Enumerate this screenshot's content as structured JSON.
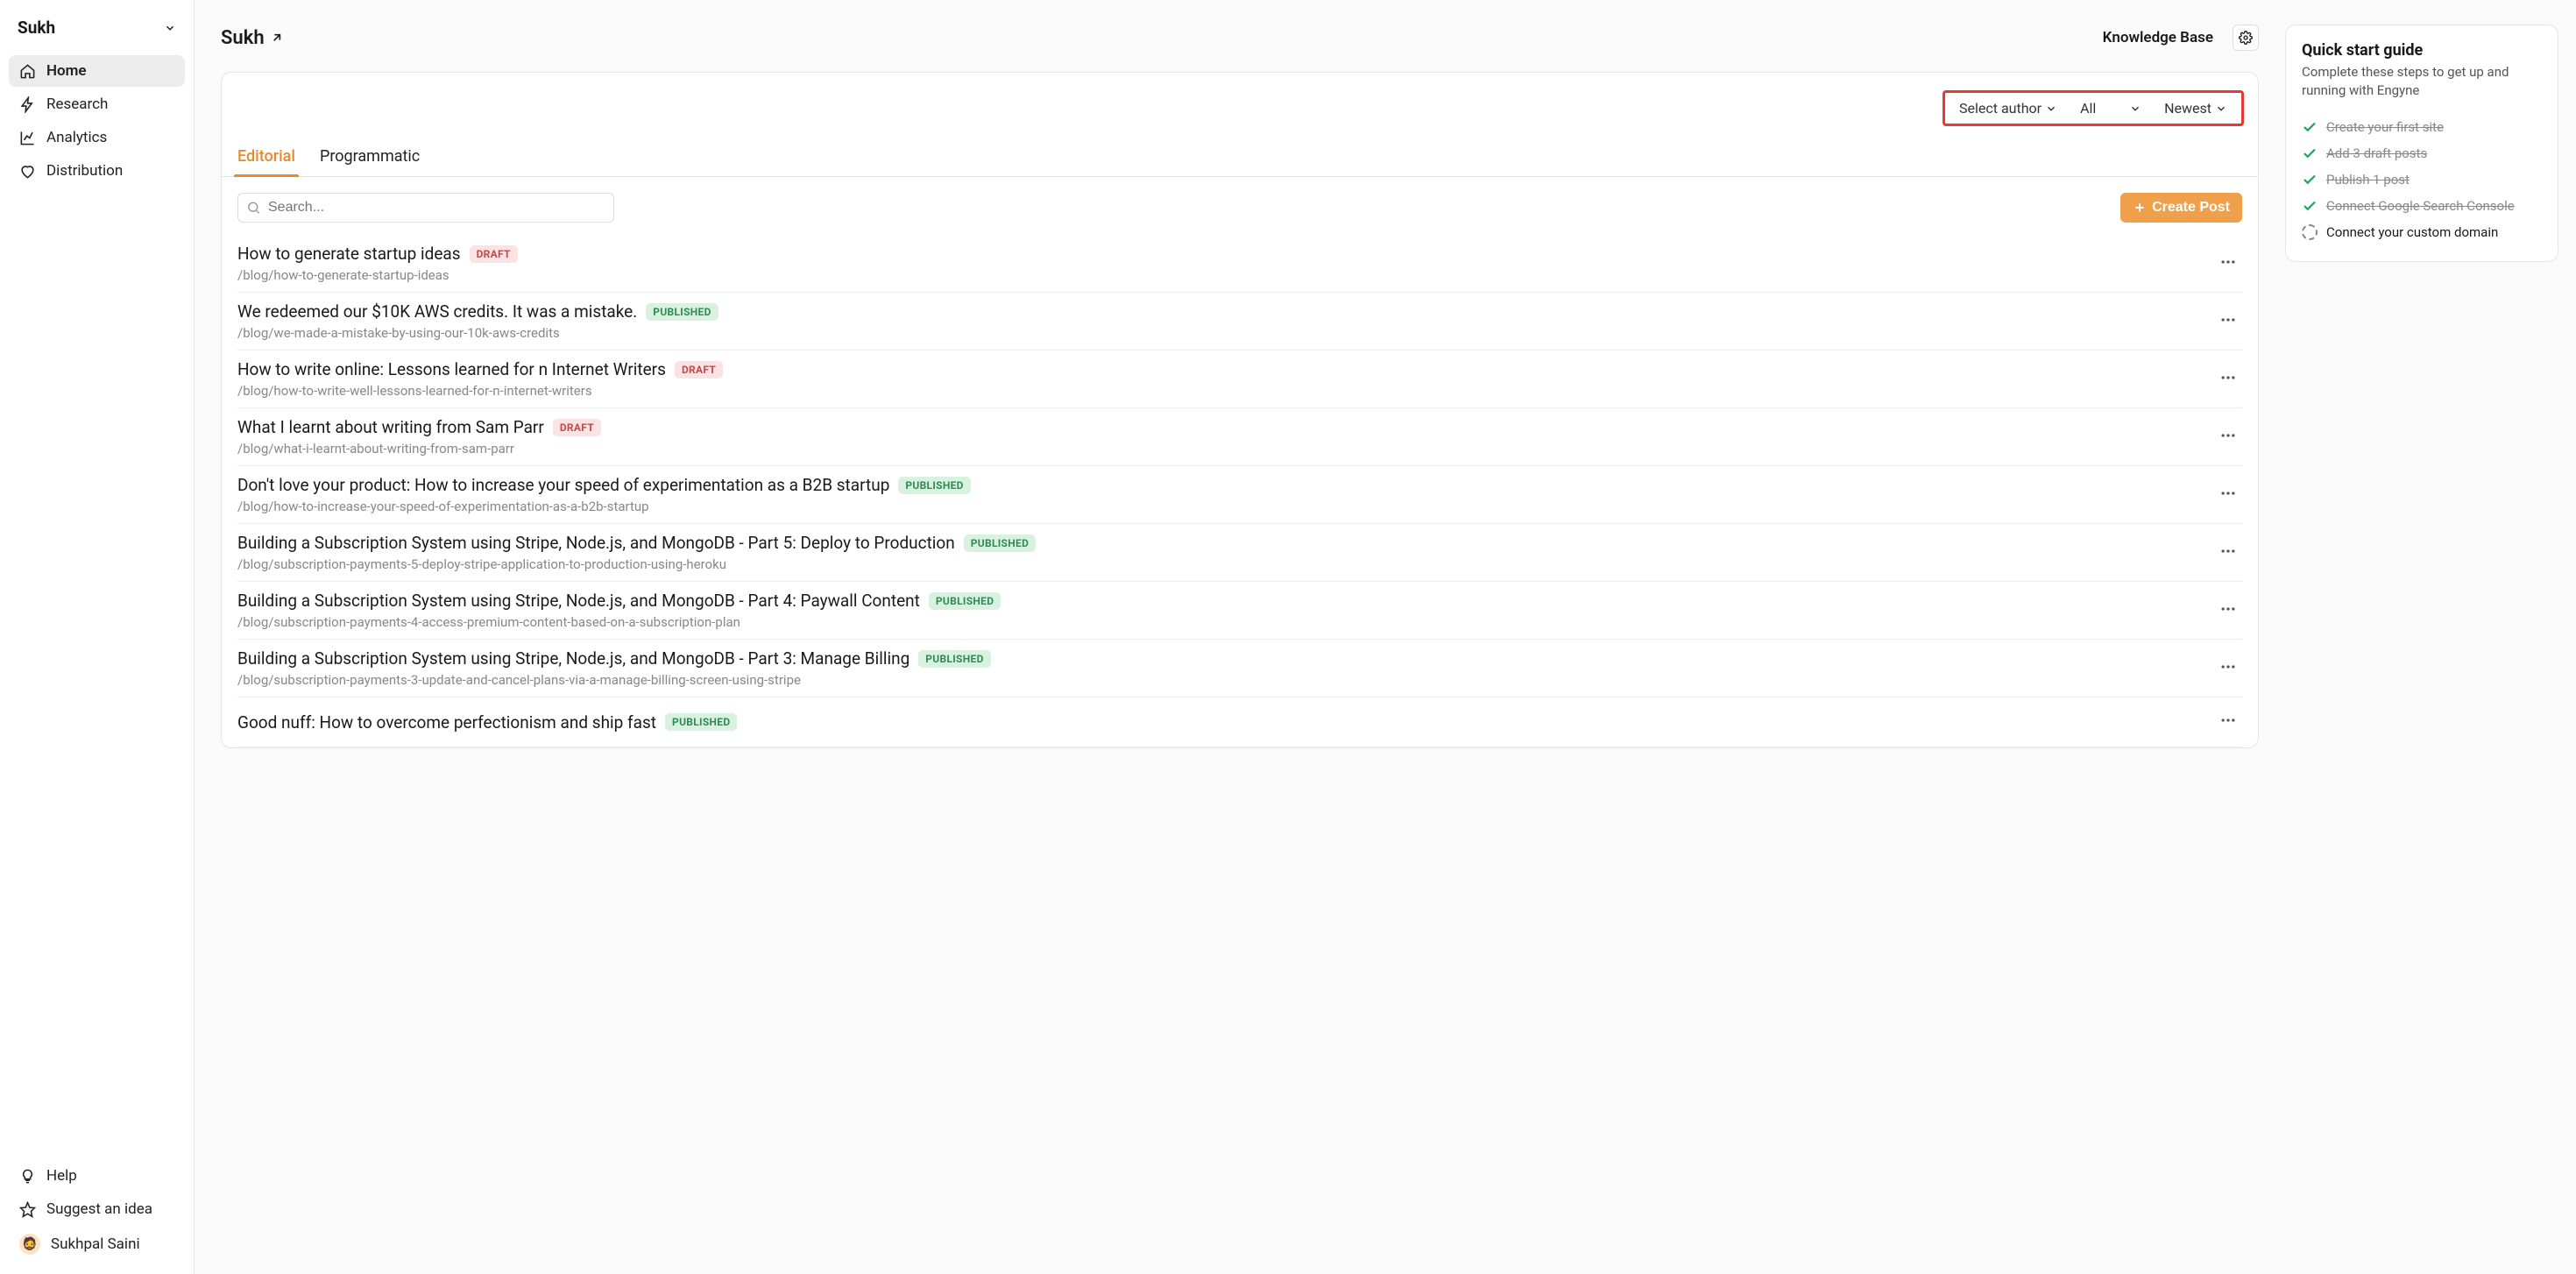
{
  "workspace": {
    "name": "Sukh"
  },
  "sidebar": {
    "items": [
      {
        "label": "Home"
      },
      {
        "label": "Research"
      },
      {
        "label": "Analytics"
      },
      {
        "label": "Distribution"
      }
    ],
    "footer": {
      "help": "Help",
      "suggest": "Suggest an idea",
      "user": "Sukhpal Saini",
      "avatar_emoji": "🧔"
    }
  },
  "header": {
    "site_name": "Sukh",
    "kb": "Knowledge Base"
  },
  "filters": {
    "author": "Select author",
    "status": "All",
    "sort": "Newest"
  },
  "tabs": {
    "editorial": "Editorial",
    "programmatic": "Programmatic"
  },
  "toolbar": {
    "search_placeholder": "Search...",
    "create_label": "Create Post"
  },
  "badges": {
    "draft": "DRAFT",
    "published": "PUBLISHED"
  },
  "posts": [
    {
      "title": "How to generate startup ideas",
      "slug": "/blog/how-to-generate-startup-ideas",
      "status": "draft"
    },
    {
      "title": "We redeemed our $10K AWS credits. It was a mistake.",
      "slug": "/blog/we-made-a-mistake-by-using-our-10k-aws-credits",
      "status": "published"
    },
    {
      "title": "How to write online: Lessons learned for n Internet Writers",
      "slug": "/blog/how-to-write-well-lessons-learned-for-n-internet-writers",
      "status": "draft"
    },
    {
      "title": "What I learnt about writing from Sam Parr",
      "slug": "/blog/what-i-learnt-about-writing-from-sam-parr",
      "status": "draft"
    },
    {
      "title": "Don't love your product: How to increase your speed of experimentation as a B2B startup",
      "slug": "/blog/how-to-increase-your-speed-of-experimentation-as-a-b2b-startup",
      "status": "published"
    },
    {
      "title": "Building a Subscription System using Stripe, Node.js, and MongoDB - Part 5: Deploy to Production",
      "slug": "/blog/subscription-payments-5-deploy-stripe-application-to-production-using-heroku",
      "status": "published"
    },
    {
      "title": "Building a Subscription System using Stripe, Node.js, and MongoDB - Part 4: Paywall Content",
      "slug": "/blog/subscription-payments-4-access-premium-content-based-on-a-subscription-plan",
      "status": "published"
    },
    {
      "title": "Building a Subscription System using Stripe, Node.js, and MongoDB - Part 3: Manage Billing",
      "slug": "/blog/subscription-payments-3-update-and-cancel-plans-via-a-manage-billing-screen-using-stripe",
      "status": "published"
    },
    {
      "title": "Good nuff: How to overcome perfectionism and ship fast",
      "slug": "",
      "status": "published"
    }
  ],
  "guide": {
    "title": "Quick start guide",
    "subtitle": "Complete these steps to get up and running with Engyne",
    "items": [
      {
        "label": "Create your first site",
        "done": true
      },
      {
        "label": "Add 3 draft posts",
        "done": true
      },
      {
        "label": "Publish 1 post",
        "done": true
      },
      {
        "label": "Connect Google Search Console",
        "done": true
      },
      {
        "label": "Connect your custom domain",
        "done": false
      }
    ]
  }
}
